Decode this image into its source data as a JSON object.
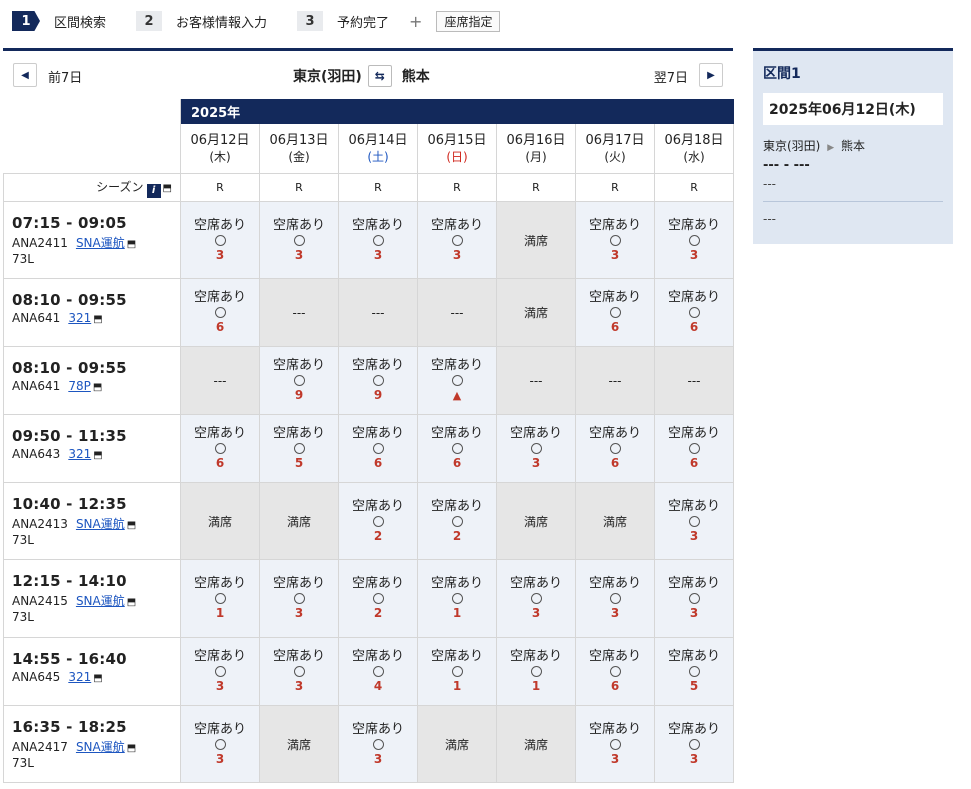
{
  "steps": [
    {
      "num": "1",
      "label": "区間検索"
    },
    {
      "num": "2",
      "label": "お客様情報入力"
    },
    {
      "num": "3",
      "label": "予約完了"
    }
  ],
  "plus": "+",
  "seat_select": "座席指定",
  "nav": {
    "prev_label": "前7日",
    "next_label": "翌7日",
    "prev_icon": "triangle-left-icon",
    "next_icon": "triangle-right-icon",
    "origin": "東京(羽田)",
    "destination": "熊本",
    "swap_icon": "swap-arrows-icon"
  },
  "year": "2025年",
  "season_label": "シーズン",
  "dates": [
    {
      "date": "06月12日",
      "dow": "(木)",
      "season": "R",
      "type": "weekday"
    },
    {
      "date": "06月13日",
      "dow": "(金)",
      "season": "R",
      "type": "weekday"
    },
    {
      "date": "06月14日",
      "dow": "(土)",
      "season": "R",
      "type": "sat"
    },
    {
      "date": "06月15日",
      "dow": "(日)",
      "season": "R",
      "type": "sun"
    },
    {
      "date": "06月16日",
      "dow": "(月)",
      "season": "R",
      "type": "weekday"
    },
    {
      "date": "06月17日",
      "dow": "(火)",
      "season": "R",
      "type": "weekday"
    },
    {
      "date": "06月18日",
      "dow": "(水)",
      "season": "R",
      "type": "weekday"
    }
  ],
  "labels": {
    "avail": "空席あり",
    "full": "満席",
    "none": "---"
  },
  "flights": [
    {
      "time": "07:15 - 09:05",
      "number": "ANA2411",
      "link": "SNA運航",
      "aircraft": "73L",
      "height": 77,
      "cells": [
        [
          "a",
          "3"
        ],
        [
          "a",
          "3"
        ],
        [
          "a",
          "3"
        ],
        [
          "a",
          "3"
        ],
        [
          "f",
          ""
        ],
        [
          "a",
          "3"
        ],
        [
          "a",
          "3"
        ]
      ]
    },
    {
      "time": "08:10 - 09:55",
      "number": "ANA641",
      "link": "321",
      "aircraft": "",
      "height": 68,
      "cells": [
        [
          "a",
          "6"
        ],
        [
          "n",
          ""
        ],
        [
          "n",
          ""
        ],
        [
          "n",
          ""
        ],
        [
          "f",
          ""
        ],
        [
          "a",
          "6"
        ],
        [
          "a",
          "6"
        ]
      ]
    },
    {
      "time": "08:10 - 09:55",
      "number": "ANA641",
      "link": "78P",
      "aircraft": "",
      "height": 68,
      "cells": [
        [
          "n",
          ""
        ],
        [
          "a",
          "9"
        ],
        [
          "a",
          "9"
        ],
        [
          "a",
          "▲"
        ],
        [
          "n",
          ""
        ],
        [
          "n",
          ""
        ],
        [
          "n",
          ""
        ]
      ]
    },
    {
      "time": "09:50 - 11:35",
      "number": "ANA643",
      "link": "321",
      "aircraft": "",
      "height": 68,
      "cells": [
        [
          "a",
          "6"
        ],
        [
          "a",
          "5"
        ],
        [
          "a",
          "6"
        ],
        [
          "a",
          "6"
        ],
        [
          "a",
          "3"
        ],
        [
          "a",
          "6"
        ],
        [
          "a",
          "6"
        ]
      ]
    },
    {
      "time": "10:40 - 12:35",
      "number": "ANA2413",
      "link": "SNA運航",
      "aircraft": "73L",
      "height": 77,
      "cells": [
        [
          "f",
          ""
        ],
        [
          "f",
          ""
        ],
        [
          "a",
          "2"
        ],
        [
          "a",
          "2"
        ],
        [
          "f",
          ""
        ],
        [
          "f",
          ""
        ],
        [
          "a",
          "3"
        ]
      ]
    },
    {
      "time": "12:15 - 14:10",
      "number": "ANA2415",
      "link": "SNA運航",
      "aircraft": "73L",
      "height": 78,
      "cells": [
        [
          "a",
          "1"
        ],
        [
          "a",
          "3"
        ],
        [
          "a",
          "2"
        ],
        [
          "a",
          "1"
        ],
        [
          "a",
          "3"
        ],
        [
          "a",
          "3"
        ],
        [
          "a",
          "3"
        ]
      ]
    },
    {
      "time": "14:55 - 16:40",
      "number": "ANA645",
      "link": "321",
      "aircraft": "",
      "height": 68,
      "cells": [
        [
          "a",
          "3"
        ],
        [
          "a",
          "3"
        ],
        [
          "a",
          "4"
        ],
        [
          "a",
          "1"
        ],
        [
          "a",
          "1"
        ],
        [
          "a",
          "6"
        ],
        [
          "a",
          "5"
        ]
      ]
    },
    {
      "time": "16:35 - 18:25",
      "number": "ANA2417",
      "link": "SNA運航",
      "aircraft": "73L",
      "height": 77,
      "cells": [
        [
          "a",
          "3"
        ],
        [
          "f",
          ""
        ],
        [
          "a",
          "3"
        ],
        [
          "f",
          ""
        ],
        [
          "f",
          ""
        ],
        [
          "a",
          "3"
        ],
        [
          "a",
          "3"
        ]
      ]
    }
  ],
  "side": {
    "title": "区間1",
    "date": "2025年06月12日(木)",
    "origin": "東京(羽田)",
    "destination": "熊本",
    "flight_placeholder": "--- - ---",
    "line1": "---",
    "line2": "---"
  },
  "colors": {
    "navy": "#13295b",
    "avail_bg": "#eef2f8",
    "gray_bg": "#e6e6e6",
    "seat_red": "#c0392b"
  }
}
